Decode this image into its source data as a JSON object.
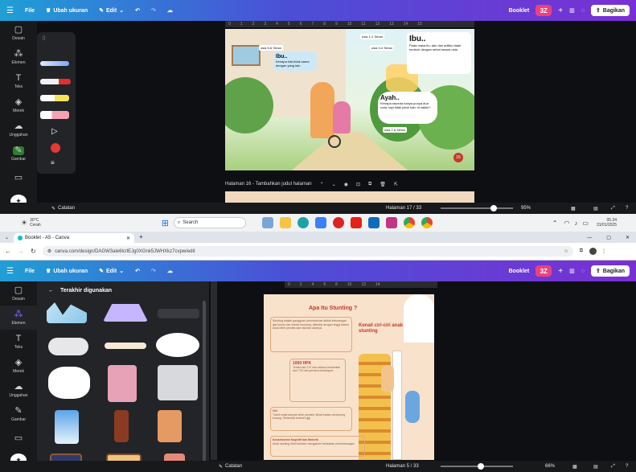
{
  "top_window": {
    "menu": {
      "file": "File",
      "resize": "Ubah ukuran",
      "edit": "Edit"
    },
    "doc_name": "Booklet",
    "avatar": "3Z",
    "share": "Bagikan",
    "rail": [
      {
        "label": "Desain",
        "icon": "layout-icon"
      },
      {
        "label": "Elemen",
        "icon": "elements-icon"
      },
      {
        "label": "Teks",
        "icon": "text-icon"
      },
      {
        "label": "Merek",
        "icon": "brand-icon"
      },
      {
        "label": "Unggahan",
        "icon": "upload-icon"
      },
      {
        "label": "Gambar",
        "icon": "draw-icon"
      },
      {
        "label": "",
        "icon": "folder-icon"
      }
    ],
    "ruler_ticks": [
      "0",
      "1",
      "2",
      "3",
      "4",
      "5",
      "6",
      "7",
      "8",
      "9",
      "10",
      "11",
      "12",
      "13",
      "14",
      "15"
    ],
    "page": {
      "label_top_right": "usia 1-2 Tahun",
      "ibu_big": "Ibu..",
      "ibu_text": "Pada masa itu, aku dan adikku tidak tumbuh dengan sehat sesuai usia",
      "usia_34": "usia 3-4 Tahun",
      "ibu_small": "Ibu..",
      "ibu_small_text": "Kenapa kita tidak sama dengan yang lain",
      "usia_56": "usia 5-6 Tahun",
      "ayah": "Ayah..",
      "ayah_text": "Kenapa sepeda hanya punya dua roda, tapi tidak jatuh kalo di naikin?",
      "usia_78": "usia 7-8 Tahun",
      "page_num": "16"
    },
    "page_footer": "Halaman 16 - Tambahkan judul halaman",
    "notes": "Catatan",
    "page_count": "Halaman 17 / 33",
    "zoom": "95%",
    "progress": 0.85
  },
  "taskbar": {
    "weather_temp": "30°C",
    "weather_desc": "Cerah",
    "search": "Search",
    "time": "05.34",
    "date": "31/01/2025"
  },
  "browser": {
    "tab_title": "Booklet - A5 - Canva",
    "url": "canva.com/design/DAGW3ale6lc/tEJg0XGnk5JWHXkz7cvpw/edit"
  },
  "bottom_window": {
    "menu": {
      "file": "File",
      "resize": "Ubah ukuran",
      "edit": "Edit"
    },
    "doc_name": "Booklet",
    "avatar": "3Z",
    "share": "Bagikan",
    "rail": [
      {
        "label": "Desain",
        "icon": "layout-icon"
      },
      {
        "label": "Elemen",
        "icon": "elements-icon"
      },
      {
        "label": "Teks",
        "icon": "text-icon"
      },
      {
        "label": "Merek",
        "icon": "brand-icon"
      },
      {
        "label": "Unggahan",
        "icon": "upload-icon"
      },
      {
        "label": "Gambar",
        "icon": "draw-icon"
      },
      {
        "label": "",
        "icon": "folder-icon"
      }
    ],
    "panel_title": "Terakhir digunakan",
    "ruler_ticks": [
      "0",
      "2",
      "4",
      "6",
      "8",
      "10",
      "12",
      "14"
    ],
    "page": {
      "title": "Apa Itu Stunting ?",
      "kenali": "Kenali ciri-ciri anak stunting",
      "intro": "Stunting adalah gangguan pertumbuhan akibat kekurangan gizi kronis dan infeksi berulang, ditandai dengan tinggi badan anak lebih pendek dari standar usianya.",
      "hpk_title": "1000 HPK",
      "hpk_text": "Terdiri dari 270 hari selama kehamilan dan 730 hari pertama kehidupan",
      "ciri_title": "Ciri",
      "ciri_text": "Tubuh anak tampak lebih pendek; Berat badan cenderung kurang; Terlambat tumbuh gigi",
      "konsekuensi_title": "Konsekuensi Kognitif dan Motorik",
      "konsekuensi_text": "Anak stunting lebih berisiko mengalami hambatan perkembangan"
    },
    "notes": "Catatan",
    "page_count": "Halaman 5 / 33",
    "zoom": "66%",
    "progress": 0.55
  },
  "colors": {
    "accent": "#7d6bff",
    "avatar": "#e8437c",
    "dark": "#18191b"
  }
}
